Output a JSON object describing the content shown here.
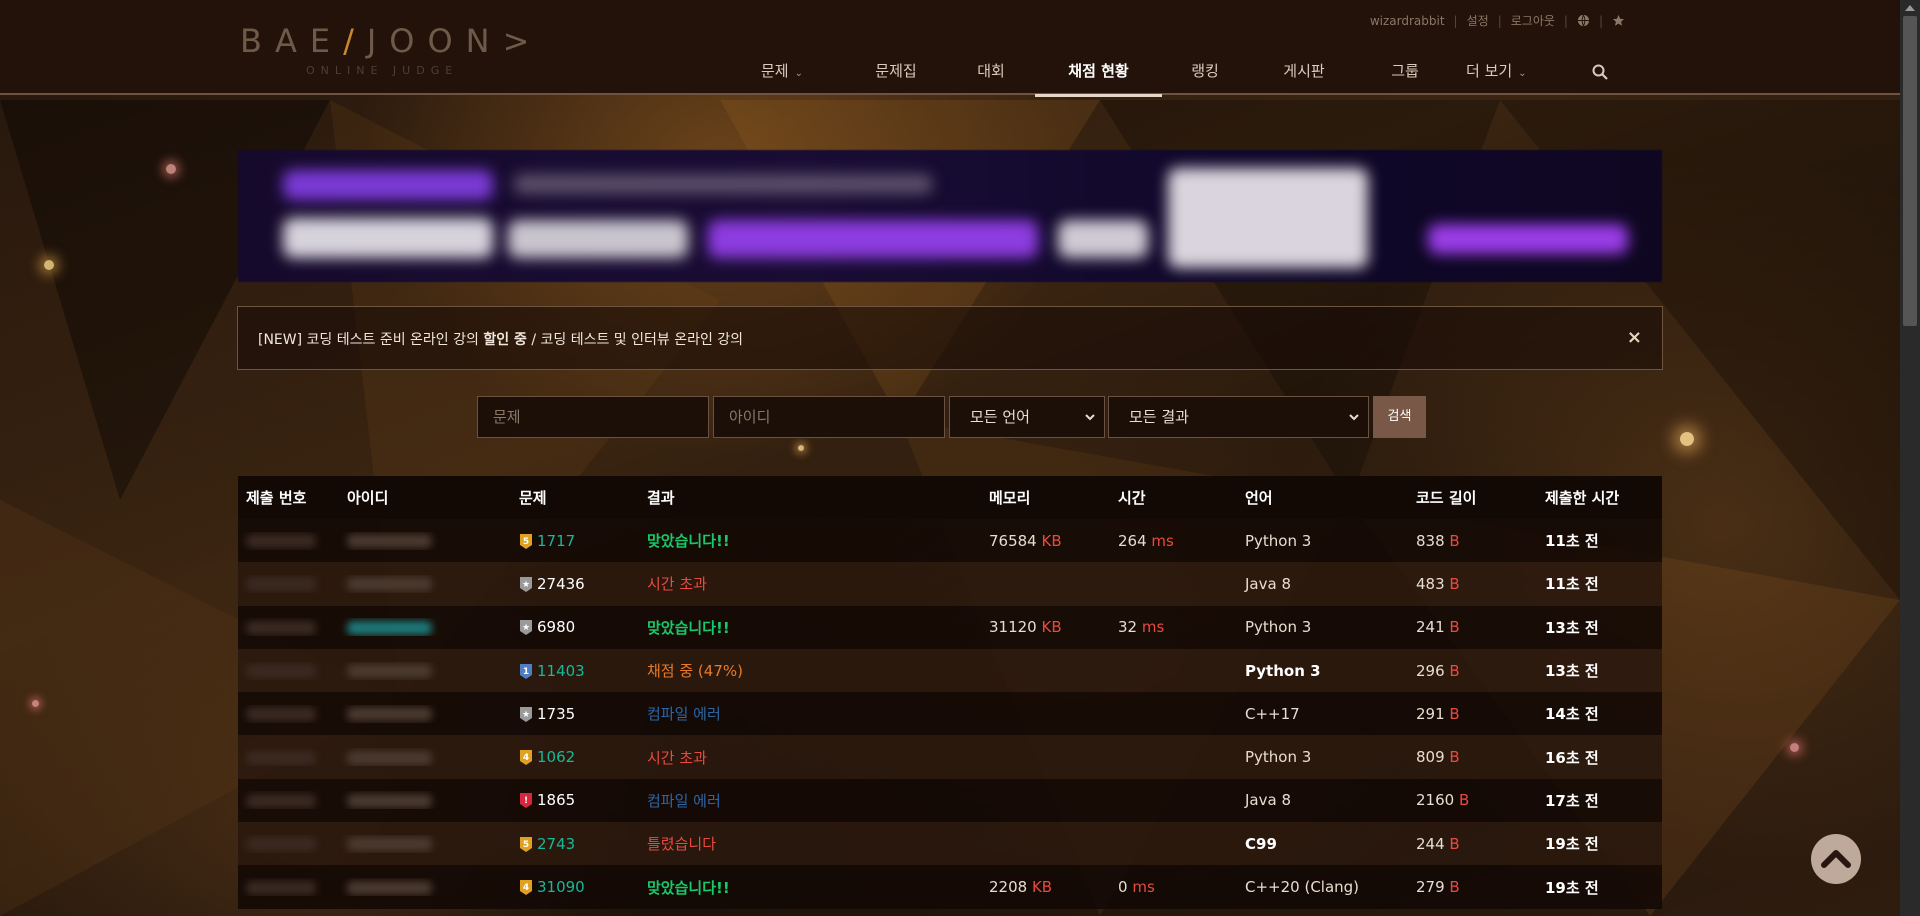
{
  "logo": {
    "main_a": "BAE",
    "main_b": "JOON",
    "sub": "ONLINE JUDGE"
  },
  "top_links": {
    "user": "wizardrabbit",
    "settings": "설정",
    "logout": "로그아웃"
  },
  "nav": [
    {
      "label": "문제",
      "dropdown": true
    },
    {
      "label": "문제집"
    },
    {
      "label": "대회"
    },
    {
      "label": "채점 현황",
      "active": true
    },
    {
      "label": "랭킹"
    },
    {
      "label": "게시판"
    },
    {
      "label": "그룹"
    },
    {
      "label": "더 보기",
      "dropdown": true
    }
  ],
  "notice": {
    "pre": "[NEW] 코딩 테스트 준비 온라인 강의 ",
    "bold": "할인 중",
    "post": " / 코딩 테스트 및 인터뷰 온라인 강의"
  },
  "filters": {
    "problem_placeholder": "문제",
    "id_placeholder": "아이디",
    "language": "모든 언어",
    "result": "모든 결과",
    "search_label": "검색"
  },
  "table": {
    "headers": [
      "제출 번호",
      "아이디",
      "문제",
      "결과",
      "메모리",
      "시간",
      "언어",
      "코드 길이",
      "제출한 시간"
    ],
    "rows": [
      {
        "tier": "gold",
        "tier_num": "5",
        "problem": "1717",
        "teal": true,
        "result": "맞았습니다!!",
        "rclass": "ok",
        "memory": "76584",
        "mem_unit": "KB",
        "time": "264",
        "time_unit": "ms",
        "lang": "Python 3",
        "lang_bold": false,
        "len": "838",
        "len_unit": "B",
        "submitted": "11초 전"
      },
      {
        "tier": "unrated",
        "tier_num": "",
        "problem": "27436",
        "teal": false,
        "result": "시간 초과",
        "rclass": "tle",
        "memory": "",
        "mem_unit": "",
        "time": "",
        "time_unit": "",
        "lang": "Java 8",
        "lang_bold": false,
        "len": "483",
        "len_unit": "B",
        "submitted": "11초 전"
      },
      {
        "tier": "unrated",
        "tier_num": "",
        "problem": "6980",
        "teal": false,
        "result": "맞았습니다!!",
        "rclass": "ok",
        "memory": "31120",
        "mem_unit": "KB",
        "time": "32",
        "time_unit": "ms",
        "lang": "Python 3",
        "lang_bold": false,
        "len": "241",
        "len_unit": "B",
        "submitted": "13초 전"
      },
      {
        "tier": "platinum",
        "tier_num": "1",
        "problem": "11403",
        "teal": true,
        "result": "채점 중 (47%)",
        "rclass": "judging",
        "memory": "",
        "mem_unit": "",
        "time": "",
        "time_unit": "",
        "lang": "Python 3",
        "lang_bold": true,
        "len": "296",
        "len_unit": "B",
        "submitted": "13초 전"
      },
      {
        "tier": "unrated",
        "tier_num": "",
        "problem": "1735",
        "teal": false,
        "result": "컴파일 에러",
        "rclass": "ce",
        "memory": "",
        "mem_unit": "",
        "time": "",
        "time_unit": "",
        "lang": "C++17",
        "lang_bold": false,
        "len": "291",
        "len_unit": "B",
        "submitted": "14초 전"
      },
      {
        "tier": "gold",
        "tier_num": "4",
        "problem": "1062",
        "teal": true,
        "result": "시간 초과",
        "rclass": "tle",
        "memory": "",
        "mem_unit": "",
        "time": "",
        "time_unit": "",
        "lang": "Python 3",
        "lang_bold": false,
        "len": "809",
        "len_unit": "B",
        "submitted": "16초 전"
      },
      {
        "tier": "ruby",
        "tier_num": "!",
        "problem": "1865",
        "teal": false,
        "result": "컴파일 에러",
        "rclass": "ce",
        "memory": "",
        "mem_unit": "",
        "time": "",
        "time_unit": "",
        "lang": "Java 8",
        "lang_bold": false,
        "len": "2160",
        "len_unit": "B",
        "submitted": "17초 전"
      },
      {
        "tier": "gold",
        "tier_num": "5",
        "problem": "2743",
        "teal": true,
        "result": "틀렸습니다",
        "rclass": "wa",
        "memory": "",
        "mem_unit": "",
        "time": "",
        "time_unit": "",
        "lang": "C99",
        "lang_bold": true,
        "len": "244",
        "len_unit": "B",
        "submitted": "19초 전"
      },
      {
        "tier": "gold",
        "tier_num": "4",
        "problem": "31090",
        "teal": true,
        "result": "맞았습니다!!",
        "rclass": "ok",
        "memory": "2208",
        "mem_unit": "KB",
        "time": "0",
        "time_unit": "ms",
        "lang": "C++20 (Clang)",
        "lang_bold": false,
        "len": "279",
        "len_unit": "B",
        "submitted": "19초 전"
      }
    ]
  },
  "colors": {
    "accepted": "#17c968",
    "wrong": "#e84a3f",
    "compile_error": "#2b66a7",
    "judging": "#e87a28",
    "gold_tier": "#e0a020",
    "teal_problem": "#17b898"
  }
}
